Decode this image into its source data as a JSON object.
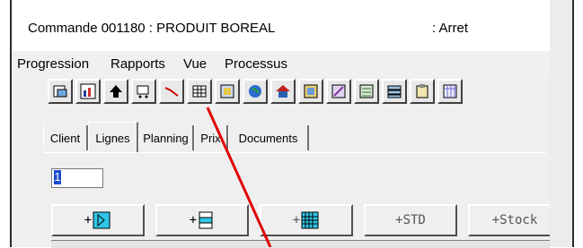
{
  "window": {
    "title": "Commande 001180 : PRODUIT BOREAL",
    "status": ": Arret"
  },
  "menubar": [
    "Progression",
    "Rapports",
    "Vue",
    "Processus"
  ],
  "toolbar_icons": [
    "report-export-icon",
    "chart-icon",
    "up-arrow-icon",
    "cart-icon",
    "line-chart-icon",
    "grid-icon",
    "table-color-icon",
    "globe-icon",
    "house-icon",
    "picture-icon",
    "tools-icon",
    "network-icon",
    "stack-icon",
    "clipboard-icon",
    "calendar-icon"
  ],
  "tabs": [
    "Client",
    "Lignes",
    "Planning",
    "Prix",
    "Documents"
  ],
  "active_tab": "Lignes",
  "line_field": {
    "value": "1"
  },
  "buttons": [
    {
      "label": "+",
      "icon": "add-frame-icon"
    },
    {
      "label": "+",
      "icon": "add-row-icon"
    },
    {
      "label": "+",
      "icon": "add-grid-icon"
    },
    {
      "label": "+STD"
    },
    {
      "label": "+Stock"
    }
  ],
  "annotation": {
    "color": "#e00000"
  }
}
